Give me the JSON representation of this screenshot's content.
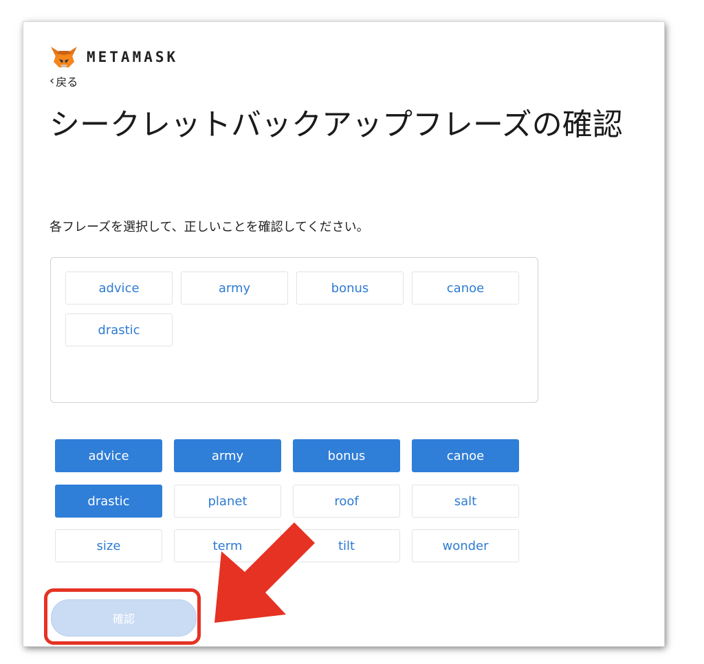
{
  "brand": {
    "name": "METAMASK",
    "logo_icon": "fox-icon"
  },
  "back": {
    "label": "戻る",
    "icon": "chevron-left-icon"
  },
  "title": "シークレットバックアップフレーズの確認",
  "subtitle": "各フレーズを選択して、正しいことを確認してください。",
  "selected_words": [
    "advice",
    "army",
    "bonus",
    "canoe",
    "drastic"
  ],
  "word_bank": [
    {
      "word": "advice",
      "selected": true
    },
    {
      "word": "army",
      "selected": true
    },
    {
      "word": "bonus",
      "selected": true
    },
    {
      "word": "canoe",
      "selected": true
    },
    {
      "word": "drastic",
      "selected": true
    },
    {
      "word": "planet",
      "selected": false
    },
    {
      "word": "roof",
      "selected": false
    },
    {
      "word": "salt",
      "selected": false
    },
    {
      "word": "size",
      "selected": false
    },
    {
      "word": "term",
      "selected": false
    },
    {
      "word": "tilt",
      "selected": false
    },
    {
      "word": "wonder",
      "selected": false
    }
  ],
  "confirm_button": {
    "label": "確認",
    "enabled": false
  },
  "colors": {
    "accent": "#2f7ed8",
    "annotation": "#e53223",
    "disabled_button": "#c9dcf4"
  }
}
